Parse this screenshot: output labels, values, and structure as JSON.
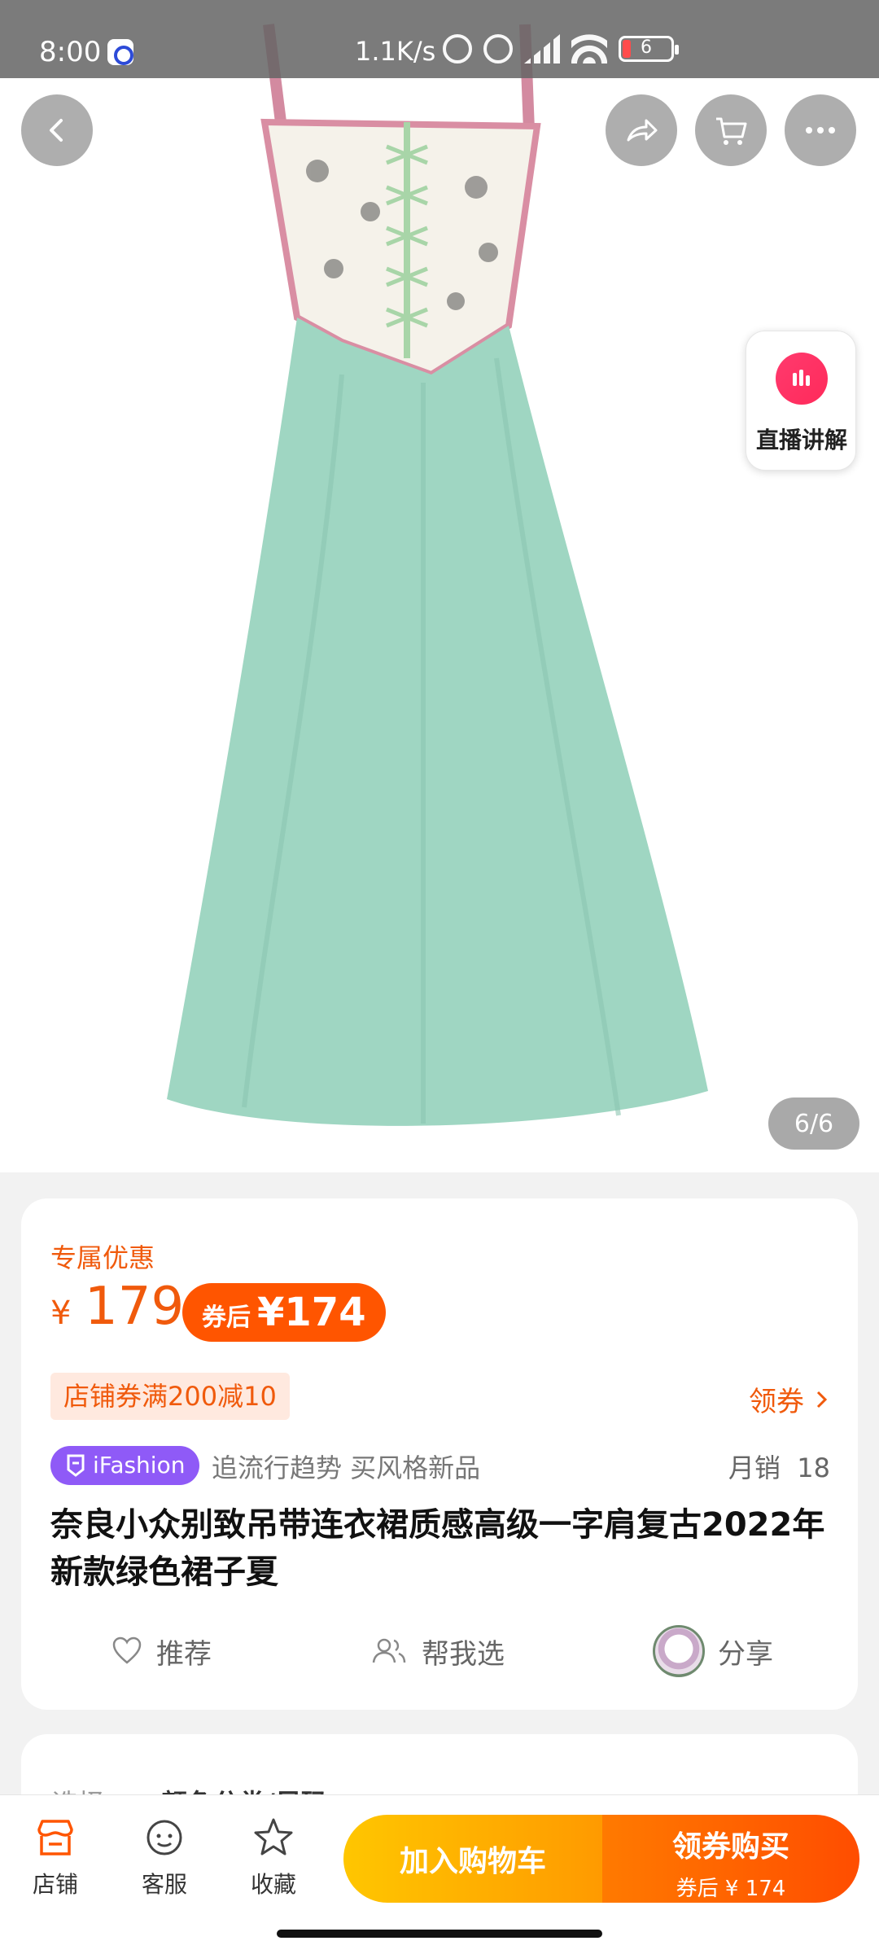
{
  "status_bar": {
    "time": "8:00",
    "net_speed": "1.1K/s",
    "battery": "6"
  },
  "image_gallery": {
    "live_label": "直播讲解",
    "counter": "6/6"
  },
  "product": {
    "exclusive_label": "专属优惠",
    "currency": "¥",
    "price": "179",
    "after_coupon_label": "券后",
    "after_coupon_price": "¥174",
    "store_coupon": "店铺券满200减10",
    "get_coupon_label": "领券",
    "brand_badge": "iFashion",
    "slogan": "追流行趋势 买风格新品",
    "monthly_sales_label": "月销",
    "monthly_sales_value": "18",
    "title": "奈良小众别致吊带连衣裙质感高级一字肩复古2022年新款绿色裙子夏"
  },
  "actions": {
    "recommend": "推荐",
    "help_choose": "帮我选",
    "share": "分享"
  },
  "options": {
    "label": "选择",
    "value": "颜色分类/尺码"
  },
  "bottom_bar": {
    "shop": "店铺",
    "service": "客服",
    "favorite": "收藏",
    "add_to_cart": "加入购物车",
    "buy_main": "领券购买",
    "buy_sub": "券后 ¥ 174"
  },
  "colors": {
    "accent": "#f05a0c",
    "brand_purple": "#8f5af7",
    "dress_green": "#9fd6c2"
  },
  "icons": [
    "back-icon",
    "share-icon",
    "cart-icon",
    "more-icon",
    "live-icon",
    "heart-icon",
    "people-icon",
    "store-icon",
    "service-icon",
    "star-icon",
    "chevron-right-icon"
  ]
}
